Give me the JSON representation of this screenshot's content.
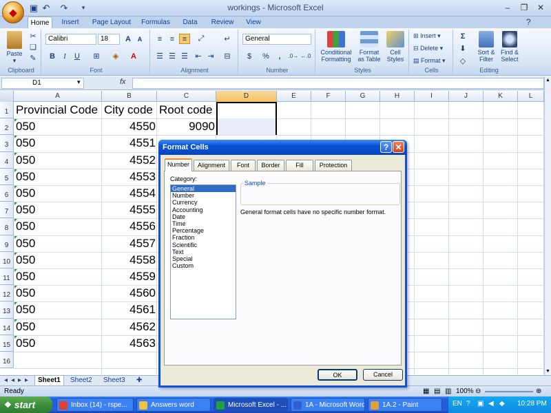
{
  "window": {
    "title": "workings - Microsoft Excel"
  },
  "ribbon": {
    "tabs": [
      "Home",
      "Insert",
      "Page Layout",
      "Formulas",
      "Data",
      "Review",
      "View"
    ],
    "clipboard": {
      "label": "Clipboard",
      "paste": "Paste"
    },
    "font": {
      "label": "Font",
      "name": "Calibri",
      "size": "18"
    },
    "alignment": {
      "label": "Alignment"
    },
    "number": {
      "label": "Number",
      "format": "General",
      "currency": "$",
      "percent": "%",
      "comma": ","
    },
    "styles": {
      "label": "Styles",
      "conditional": [
        "Conditional",
        "Formatting"
      ],
      "table": [
        "Format",
        "as Table"
      ],
      "cell": [
        "Cell",
        "Styles"
      ]
    },
    "cells": {
      "label": "Cells",
      "insert": "Insert",
      "delete": "Delete",
      "format": "Format"
    },
    "editing": {
      "label": "Editing",
      "sort": [
        "Sort &",
        "Filter"
      ],
      "find": [
        "Find &",
        "Select"
      ]
    }
  },
  "formula_bar": {
    "name_box": "D1",
    "fx": "fx",
    "value": ""
  },
  "grid": {
    "columns": [
      "A",
      "B",
      "C",
      "D",
      "E",
      "F",
      "G",
      "H",
      "I",
      "J",
      "K",
      "L"
    ],
    "rows": [
      "1",
      "2",
      "3",
      "4",
      "5",
      "6",
      "7",
      "8",
      "9",
      "10",
      "11",
      "12",
      "13",
      "14",
      "15",
      "16"
    ],
    "headers": [
      "Provincial Code",
      "City code",
      "Root code"
    ],
    "col_a": [
      "050",
      "050",
      "050",
      "050",
      "050",
      "050",
      "050",
      "050",
      "050",
      "050",
      "050",
      "050",
      "050",
      "050"
    ],
    "col_b": [
      "4550",
      "4551",
      "4552",
      "4553",
      "4554",
      "4555",
      "4556",
      "4557",
      "4558",
      "4559",
      "4560",
      "4561",
      "4562",
      "4563"
    ],
    "col_c": [
      "9090"
    ]
  },
  "sheets": [
    "Sheet1",
    "Sheet2",
    "Sheet3"
  ],
  "status": {
    "ready": "Ready",
    "zoom": "100%"
  },
  "dialog": {
    "title": "Format Cells",
    "tabs": [
      "Number",
      "Alignment",
      "Font",
      "Border",
      "Fill",
      "Protection"
    ],
    "category_label": "Category:",
    "categories": [
      "General",
      "Number",
      "Currency",
      "Accounting",
      "Date",
      "Time",
      "Percentage",
      "Fraction",
      "Scientific",
      "Text",
      "Special",
      "Custom"
    ],
    "selected_category": "General",
    "sample_label": "Sample",
    "description": "General format cells have no specific number format.",
    "ok": "OK",
    "cancel": "Cancel"
  },
  "taskbar": {
    "start": "start",
    "tasks": [
      "Inbox (14) - rspe...",
      "Answers word",
      "Microsoft Excel - ...",
      "1A - Microsoft Word",
      "1A.2 - Paint"
    ],
    "lang": "EN",
    "clock": "10:28 PM"
  }
}
